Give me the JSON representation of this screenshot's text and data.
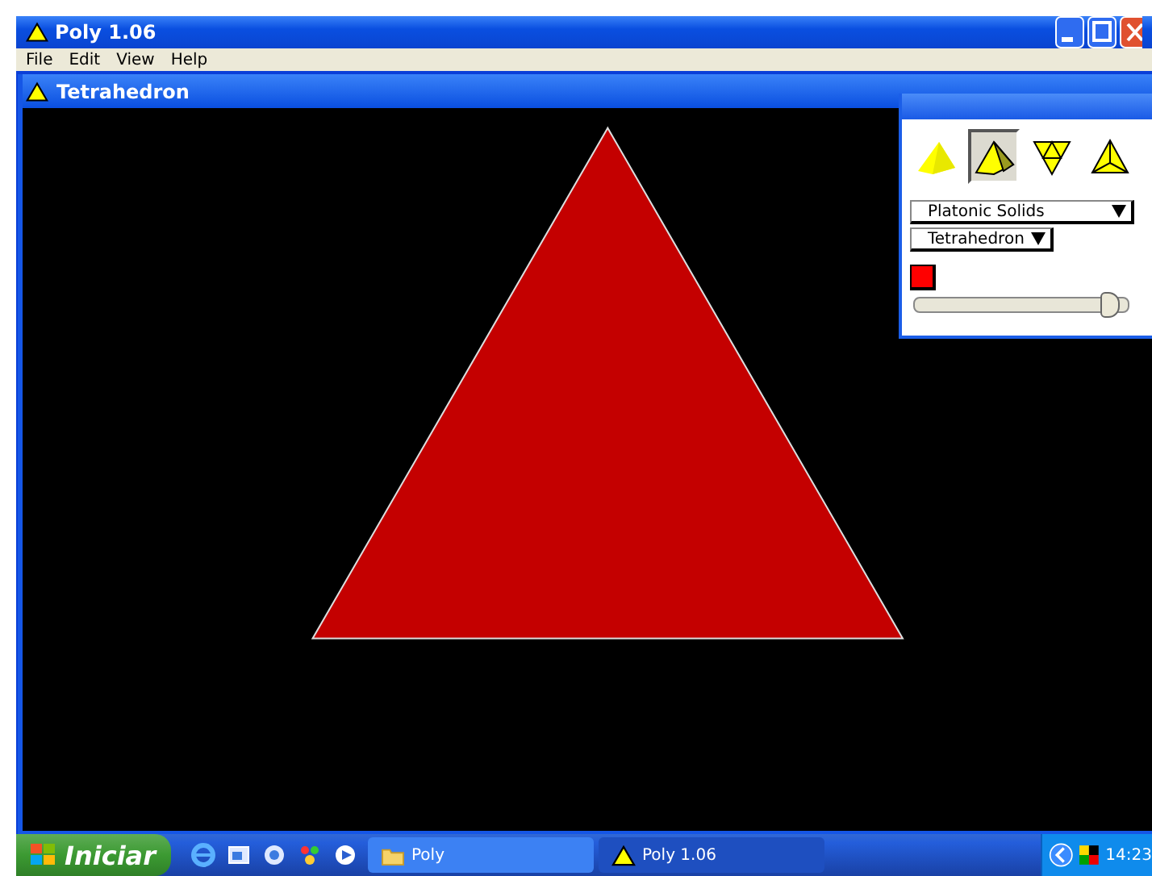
{
  "window": {
    "title": "Poly 1.06"
  },
  "menu": [
    {
      "label": "File"
    },
    {
      "label": "Edit"
    },
    {
      "label": "View"
    },
    {
      "label": "Help"
    }
  ],
  "child_window": {
    "title": "Tetrahedron"
  },
  "tool_palette": {
    "views": [
      {
        "kind": "solid",
        "selected": false
      },
      {
        "kind": "shaded",
        "selected": true
      },
      {
        "kind": "net",
        "selected": false
      },
      {
        "kind": "wire",
        "selected": false
      }
    ],
    "dropdowns": [
      {
        "value": "Platonic Solids"
      },
      {
        "value": "Tetrahedron"
      }
    ],
    "slider": {
      "level": 0.98
    }
  },
  "taskbar": {
    "start": "Iniciar",
    "tasks": [
      {
        "label": "Poly",
        "kind": "folder",
        "selected": false
      },
      {
        "label": "Poly 1.06",
        "kind": "app",
        "selected": true
      }
    ],
    "clock": "14:23"
  }
}
